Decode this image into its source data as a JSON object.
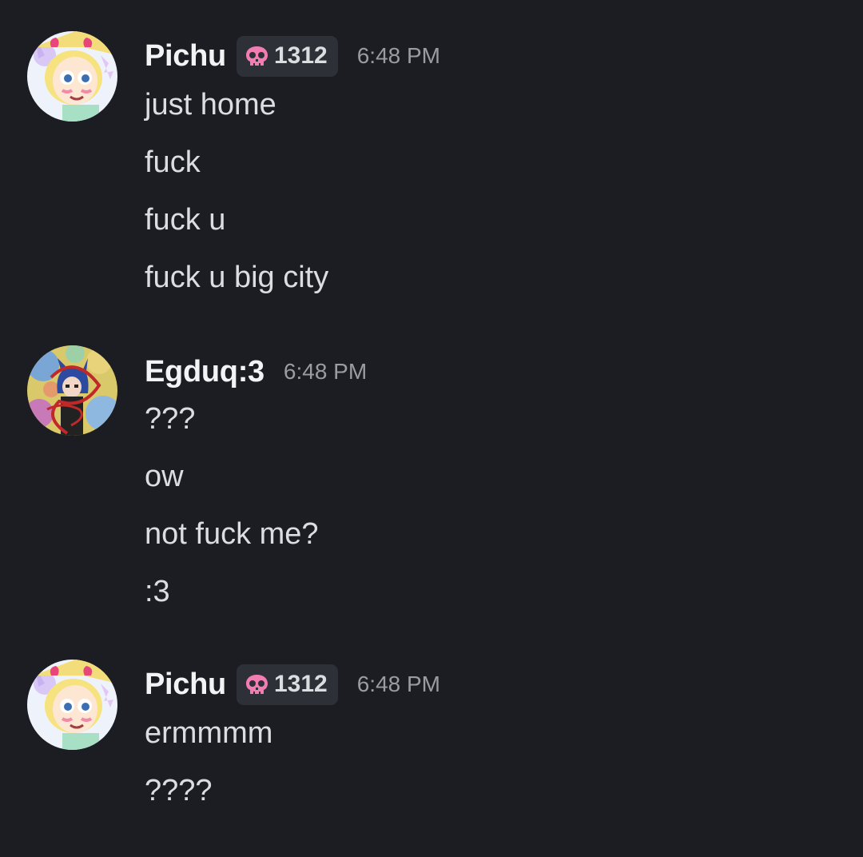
{
  "colors": {
    "background": "#1c1d22",
    "username": "#f2f3f5",
    "message_text": "#dbdee1",
    "timestamp": "#9a9ca3",
    "tag_background": "#2e3037",
    "tag_skull": "#f27db3"
  },
  "messages": [
    {
      "author": "Pichu",
      "avatar_icon": "star-butterfly-avatar",
      "tag": {
        "icon": "pink-skull-icon",
        "text": "1312"
      },
      "time": "6:48 PM",
      "lines": [
        "just home",
        "fuck",
        "fuck u",
        "fuck u big city"
      ]
    },
    {
      "author": "Egduq:3",
      "avatar_icon": "blue-hair-character-avatar",
      "time": "6:48 PM",
      "lines": [
        "???",
        "ow",
        "not fuck me?",
        ":3"
      ]
    },
    {
      "author": "Pichu",
      "avatar_icon": "star-butterfly-avatar",
      "tag": {
        "icon": "pink-skull-icon",
        "text": "1312"
      },
      "time": "6:48 PM",
      "lines": [
        "ermmmm",
        "????"
      ]
    }
  ]
}
